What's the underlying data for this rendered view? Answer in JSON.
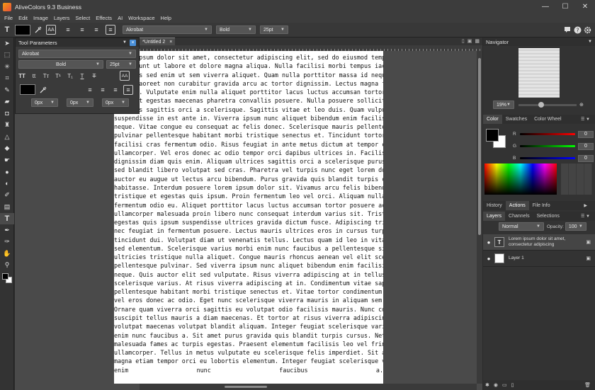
{
  "window": {
    "title": "AliveColors 9.3 Business",
    "min": "—",
    "max": "☐",
    "close": "✕"
  },
  "menu": [
    "File",
    "Edit",
    "Image",
    "Layers",
    "Select",
    "Effects",
    "AI",
    "Workspace",
    "Help"
  ],
  "options": {
    "font": "Akrobat",
    "weight": "Bold",
    "size": "25pt"
  },
  "doc_tab": "*Untitled 2",
  "doc_tab_close": "×",
  "tool_params": {
    "title": "Tool Parameters",
    "font": "Akrobat",
    "weight": "Bold",
    "size": "25pt",
    "style_buttons": [
      "TT",
      "tt",
      "Tт",
      "T¹",
      "T₁",
      "T",
      "T"
    ],
    "aa": "AA",
    "spacing": [
      "0px",
      "0px",
      "0px"
    ]
  },
  "navigator": {
    "title": "Navigator",
    "zoom": "19%"
  },
  "color_panel": {
    "tabs": [
      "Color",
      "Swatches",
      "Color Wheel"
    ],
    "r": "0",
    "g": "0",
    "b": "0",
    "labels": [
      "R",
      "G",
      "B"
    ]
  },
  "history_tabs": [
    "History",
    "Actions",
    "File Info"
  ],
  "layers": {
    "tabs": [
      "Layers",
      "Channels",
      "Selections"
    ],
    "blend": "Normal",
    "opacity_label": "Opacity:",
    "opacity": "100",
    "items": [
      {
        "name": "Lorem ipsum dolor sit amet, consectetur adipiscing",
        "kind": "T"
      },
      {
        "name": "Layer 1",
        "kind": ""
      }
    ]
  },
  "text_lines": [
    "Lorem ipsum dolor sit amet, consectetur adipiscing elit, sed do eiusmod tempor",
    "incididunt ut labore et dolore magna aliqua. Nulla facilisi morbi tempus iaculis. Diam",
    "maecenas sed enim ut sem viverra aliquet. Quam nulla porttitor massa id neque. Volutpat",
    "lacus laoreet non curabitur gravida arcu ac tortor dignissim. Lectus magna fringilla urna porttitor",
    "rhoncus. Vulputate enim nulla aliquet porttitor lacus luctus accumsan tortor posuere.",
    "Volutpat egestas maecenas pharetra convallis posuere. Nulla posuere sollicitudin aliquam",
    "ultrices sagittis orci a scelerisque. Sagittis vitae et leo duis. Quam vulputate dignissim",
    "suspendisse in est ante in. Viverra ipsum nunc aliquet bibendum enim facilisis gravida",
    "neque. Vitae congue eu consequat ac felis donec. Scelerisque mauris pellentesque",
    "pulvinar pellentesque habitant morbi tristique senectus et. Tincidunt tortor aliquam nulla",
    "facilisi cras fermentum odio. Risus feugiat in ante metus dictum at tempor commodo",
    "ullamcorper. Vel eros donec ac odio tempor orci dapibus ultrices in. Facilisi etiam",
    "dignissim diam quis enim. Aliquam ultrices sagittis orci a scelerisque purus semper. Nunc",
    "sed blandit libero volutpat sed cras. Pharetra vel turpis nunc eget lorem dolor sed. Vitae",
    "auctor eu augue ut lectus arcu bibendum. Purus gravida quis blandit turpis cursus in hac",
    "habitasse. Interdum posuere lorem ipsum dolor sit. Vivamus arcu felis bibendum ut",
    "tristique et egestas quis ipsum. Proin fermentum leo vel orci. Aliquam nulla facilisi cras",
    "fermentum odio eu. Aliquet porttitor lacus luctus accumsan tortor posuere ac. Ligula",
    "ullamcorper malesuada proin libero nunc consequat interdum varius sit. Tristique et",
    "egestas quis ipsum suspendisse ultrices gravida dictum fusce. Adipiscing tristique risus",
    "nec feugiat in fermentum posuere. Lectus mauris ultrices eros in cursus turpis massa",
    "tincidunt dui. Volutpat diam ut venenatis tellus. Lectus quam id leo in vitae turpis massa",
    "sed elementum. Scelerisque varius morbi enim nunc faucibus a pellentesque sit. Risus",
    "ultricies tristique nulla aliquet. Congue mauris rhoncus aenean vel elit scelerisque mauris",
    "pellentesque pulvinar. Sed viverra ipsum nunc aliquet bibendum enim facilisis gravida",
    "neque. Quis auctor elit sed vulputate. Risus viverra adipiscing at in tellus integer feugiat",
    "scelerisque varius. At risus viverra adipiscing at in. Condimentum vitae sapien",
    "pellentesque habitant morbi tristique senectus et. Vitae tortor condimentum lacinia quis",
    "vel eros donec ac odio. Eget nunc scelerisque viverra mauris in aliquam sem fringilla ut.",
    "Ornare quam viverra orci sagittis eu volutpat odio facilisis mauris. Nunc congue nisi vitae",
    "suscipit tellus mauris a diam maecenas. Et tortor at risus viverra adipiscing at in. Blandit",
    "volutpat maecenas volutpat blandit aliquam. Integer feugiat scelerisque varius morbi",
    "enim nunc faucibus a. Sit amet purus gravida quis blandit turpis cursus. Netus et",
    "malesuada fames ac turpis egestas. Praesent elementum facilisis leo vel fringilla est",
    "ullamcorper. Tellus in metus vulputate eu scelerisque felis imperdiet. Sit amet facilisis",
    "magna etiam tempor orci eu lobortis elementum. Integer feugiat scelerisque varius morbi",
    "enim nunc faucibus a."
  ]
}
